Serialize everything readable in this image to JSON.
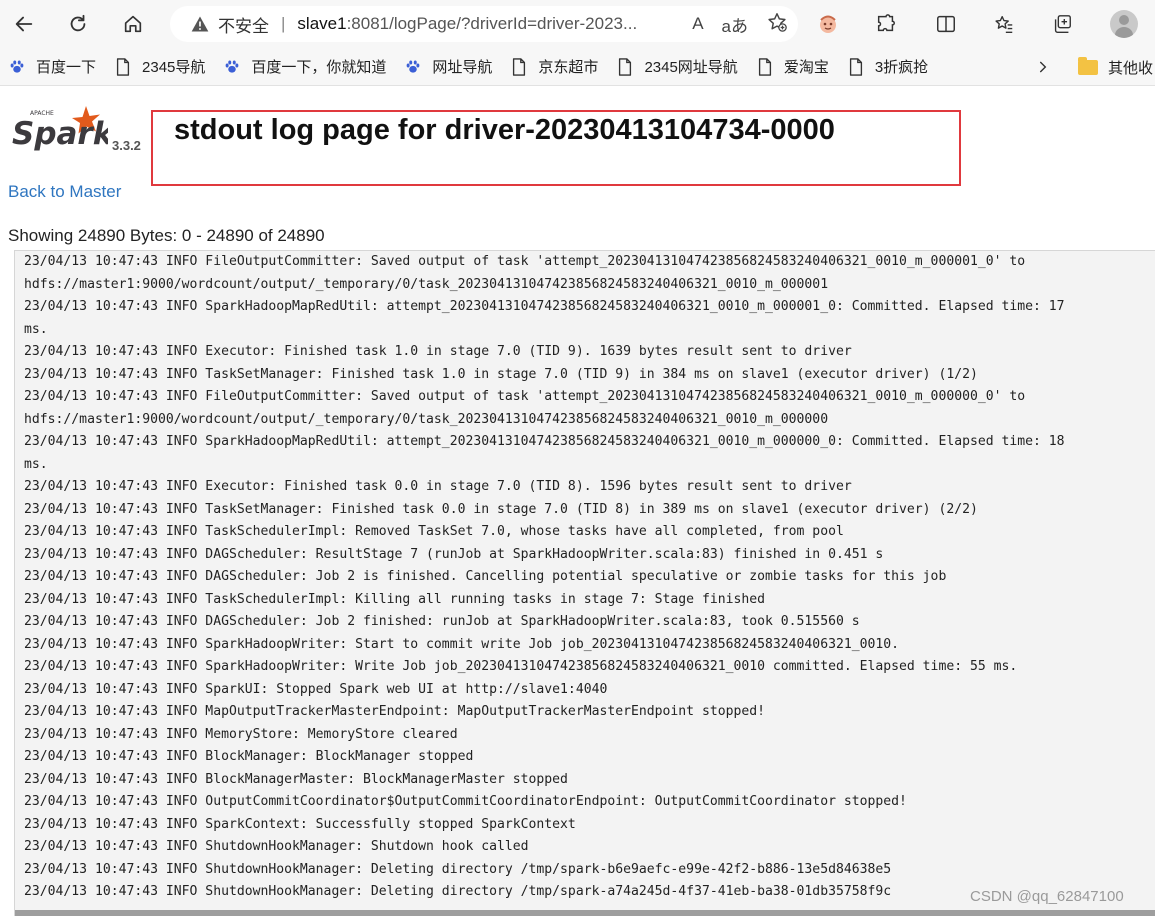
{
  "browser": {
    "security_label": "不安全",
    "url_host": "slave1",
    "url_rest": ":8081/logPage/?driverId=driver-2023...",
    "reader_icon_text": "A",
    "translate_icon_text": "aあ"
  },
  "bookmarks": [
    {
      "label": "百度一下",
      "icon": "baidu-paw-icon"
    },
    {
      "label": "2345导航",
      "icon": "page-icon"
    },
    {
      "label": "百度一下，你就知道",
      "icon": "baidu-paw-icon"
    },
    {
      "label": "网址导航",
      "icon": "baidu-paw-icon"
    },
    {
      "label": "京东超市",
      "icon": "page-icon"
    },
    {
      "label": "2345网址导航",
      "icon": "page-icon"
    },
    {
      "label": "爱淘宝",
      "icon": "page-icon"
    },
    {
      "label": "3折疯抢",
      "icon": "page-icon"
    }
  ],
  "bookmarks_other": "其他收",
  "page": {
    "logo_text": "Spark",
    "logo_sup": "APACHE",
    "version": "3.3.2",
    "title": "stdout log page for driver-20230413104734-0000",
    "back_link": "Back to Master",
    "showing": "Showing 24890 Bytes: 0 - 24890 of 24890"
  },
  "log_lines": [
    "23/04/13 10:47:43 INFO FileOutputCommitter: Saved output of task 'attempt_202304131047423856824583240406321_0010_m_000001_0' to",
    "hdfs://master1:9000/wordcount/output/_temporary/0/task_202304131047423856824583240406321_0010_m_000001",
    "23/04/13 10:47:43 INFO SparkHadoopMapRedUtil: attempt_202304131047423856824583240406321_0010_m_000001_0: Committed. Elapsed time: 17",
    "ms.",
    "23/04/13 10:47:43 INFO Executor: Finished task 1.0 in stage 7.0 (TID 9). 1639 bytes result sent to driver",
    "23/04/13 10:47:43 INFO TaskSetManager: Finished task 1.0 in stage 7.0 (TID 9) in 384 ms on slave1 (executor driver) (1/2)",
    "23/04/13 10:47:43 INFO FileOutputCommitter: Saved output of task 'attempt_202304131047423856824583240406321_0010_m_000000_0' to",
    "hdfs://master1:9000/wordcount/output/_temporary/0/task_202304131047423856824583240406321_0010_m_000000",
    "23/04/13 10:47:43 INFO SparkHadoopMapRedUtil: attempt_202304131047423856824583240406321_0010_m_000000_0: Committed. Elapsed time: 18",
    "ms.",
    "23/04/13 10:47:43 INFO Executor: Finished task 0.0 in stage 7.0 (TID 8). 1596 bytes result sent to driver",
    "23/04/13 10:47:43 INFO TaskSetManager: Finished task 0.0 in stage 7.0 (TID 8) in 389 ms on slave1 (executor driver) (2/2)",
    "23/04/13 10:47:43 INFO TaskSchedulerImpl: Removed TaskSet 7.0, whose tasks have all completed, from pool",
    "23/04/13 10:47:43 INFO DAGScheduler: ResultStage 7 (runJob at SparkHadoopWriter.scala:83) finished in 0.451 s",
    "23/04/13 10:47:43 INFO DAGScheduler: Job 2 is finished. Cancelling potential speculative or zombie tasks for this job",
    "23/04/13 10:47:43 INFO TaskSchedulerImpl: Killing all running tasks in stage 7: Stage finished",
    "23/04/13 10:47:43 INFO DAGScheduler: Job 2 finished: runJob at SparkHadoopWriter.scala:83, took 0.515560 s",
    "23/04/13 10:47:43 INFO SparkHadoopWriter: Start to commit write Job job_202304131047423856824583240406321_0010.",
    "23/04/13 10:47:43 INFO SparkHadoopWriter: Write Job job_202304131047423856824583240406321_0010 committed. Elapsed time: 55 ms.",
    "23/04/13 10:47:43 INFO SparkUI: Stopped Spark web UI at http://slave1:4040",
    "23/04/13 10:47:43 INFO MapOutputTrackerMasterEndpoint: MapOutputTrackerMasterEndpoint stopped!",
    "23/04/13 10:47:43 INFO MemoryStore: MemoryStore cleared",
    "23/04/13 10:47:43 INFO BlockManager: BlockManager stopped",
    "23/04/13 10:47:43 INFO BlockManagerMaster: BlockManagerMaster stopped",
    "23/04/13 10:47:43 INFO OutputCommitCoordinator$OutputCommitCoordinatorEndpoint: OutputCommitCoordinator stopped!",
    "23/04/13 10:47:43 INFO SparkContext: Successfully stopped SparkContext",
    "23/04/13 10:47:43 INFO ShutdownHookManager: Shutdown hook called",
    "23/04/13 10:47:43 INFO ShutdownHookManager: Deleting directory /tmp/spark-b6e9aefc-e99e-42f2-b886-13e5d84638e5",
    "23/04/13 10:47:43 INFO ShutdownHookManager: Deleting directory /tmp/spark-a74a245d-4f37-41eb-ba38-01db35758f9c"
  ],
  "watermark": "CSDN @qq_62847100",
  "colors": {
    "title_box_border": "#e0393e",
    "link": "#2f76c0",
    "log_background": "#f3f3f3",
    "spark_orange": "#e25a1c"
  }
}
